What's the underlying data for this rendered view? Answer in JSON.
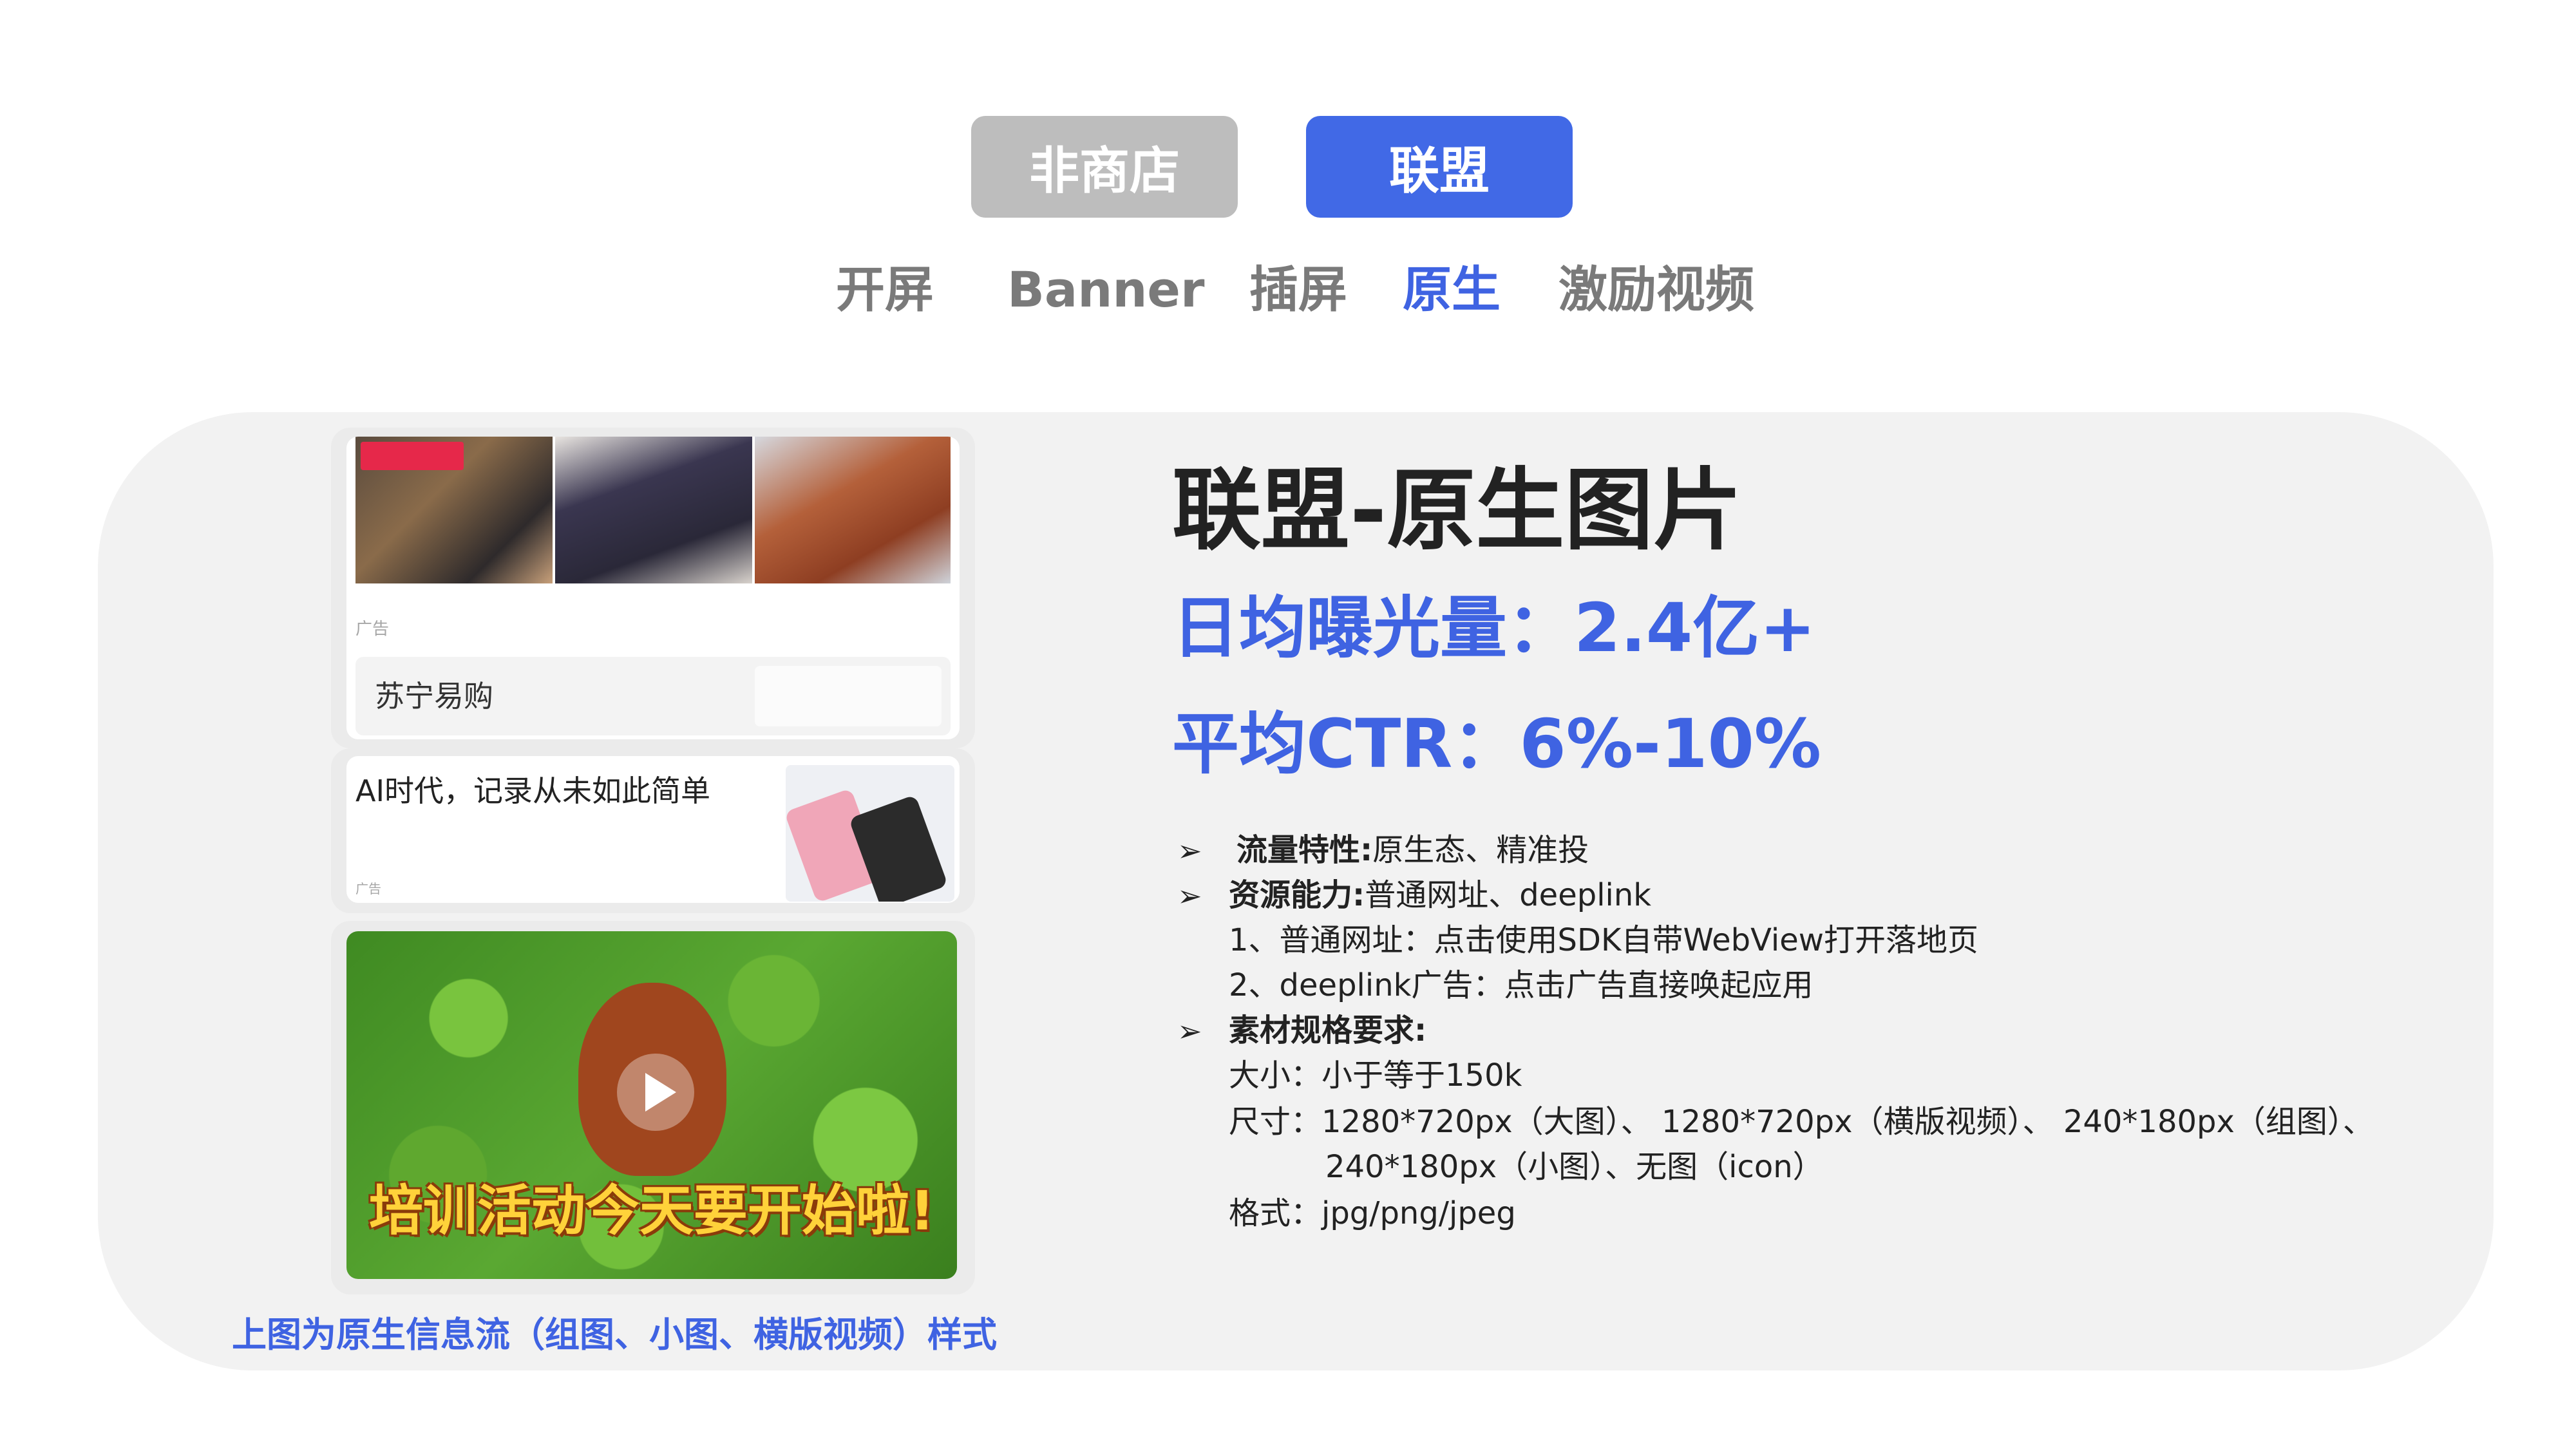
{
  "toggle": {
    "inactive_label": "非商店",
    "active_label": "联盟"
  },
  "tabs": [
    {
      "label": "开屏",
      "active": false
    },
    {
      "label": "Banner",
      "active": false
    },
    {
      "label": "插屏",
      "active": false
    },
    {
      "label": "原生",
      "active": true
    },
    {
      "label": "激励视频",
      "active": false
    }
  ],
  "colors": {
    "accent": "#3f63e2",
    "inactive": "#bdbdbd",
    "panel": "#f2f2f2"
  },
  "examples": {
    "group_card": {
      "ad_tag": "广告",
      "brand": "苏宁易购"
    },
    "small_card": {
      "title": "AI时代，记录从未如此简单",
      "ad_tag": "广告"
    },
    "video_card": {
      "caption": "培训活动今天要开始啦!",
      "play_icon": "play-icon"
    },
    "caption": "上图为原生信息流（组图、小图、横版视频）样式"
  },
  "info": {
    "title": "联盟-原生图片",
    "daily_exposure": "日均曝光量：2.4亿+",
    "avg_ctr": "平均CTR：6%-10%",
    "bullet_glyph": "➢",
    "traffic_label": "流量特性:",
    "traffic_value": "原生态、精准投",
    "resource_label": "资源能力:",
    "resource_value": "普通网址、deeplink",
    "resource_line1": "1、普通网址：点击使用SDK自带WebView打开落地页",
    "resource_line2": "2、deeplink广告：点击广告直接唤起应用",
    "material_label": "素材规格要求:",
    "size_line": "大小：小于等于150k",
    "dims_line1": "尺寸：1280*720px（大图）、 1280*720px（横版视频）、 240*180px（组图）、",
    "dims_line2": "240*180px（小图）、无图（icon）",
    "format_line": "格式：jpg/png/jpeg"
  }
}
